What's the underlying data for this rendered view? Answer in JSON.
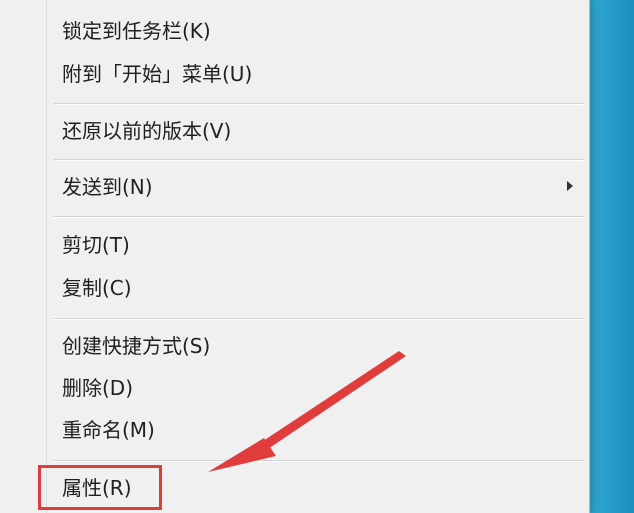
{
  "context_menu": {
    "items": [
      {
        "label": "锁定到任务栏(K)"
      },
      {
        "label": "附到「开始」菜单(U)"
      },
      {
        "label": "还原以前的版本(V)"
      },
      {
        "label": "发送到(N)",
        "submenu_icon": "chevron-right-icon"
      },
      {
        "label": "剪切(T)"
      },
      {
        "label": "复制(C)"
      },
      {
        "label": "创建快捷方式(S)"
      },
      {
        "label": "删除(D)"
      },
      {
        "label": "重命名(M)"
      },
      {
        "label": "属性(R)"
      }
    ]
  },
  "annotation": {
    "highlight_color": "#e13c3c",
    "arrow_icon": "red-pointer-arrow-icon"
  },
  "colors": {
    "menu_background": "#f0f0f0",
    "desktop_accent": "#1d8fbf"
  }
}
